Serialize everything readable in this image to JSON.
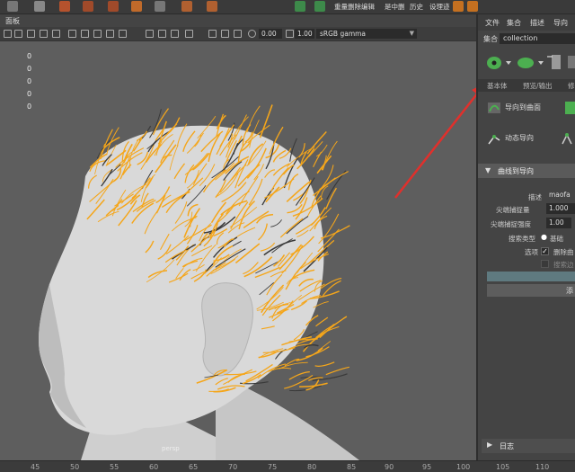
{
  "colors": {
    "hair": "#f5a61a",
    "head": "#d9d9d9",
    "viewport_bg": "#5e5e5e",
    "panel_bg": "#444444",
    "annotation_arrow": "#e0302c",
    "accent_green": "#4caf50"
  },
  "top_toolbar": {
    "labels": [
      "重量删除编辑",
      "是中删",
      "历史",
      "设理迹"
    ]
  },
  "viewport": {
    "panel_menu_label": "面板",
    "zero_readouts": [
      "0",
      "0",
      "0",
      "0",
      "0"
    ],
    "field_value_1": "0.00",
    "field_value_2": "1.00",
    "color_space": "sRGB gamma",
    "camera_label": "persp"
  },
  "right_panel": {
    "menu": [
      "文件",
      "集合",
      "描述",
      "导向"
    ],
    "collection_label": "集合",
    "collection_value": "collection",
    "tabs": [
      "基本体",
      "预览/输出",
      "修"
    ],
    "tools": {
      "guide_to_curve": "导向到曲面",
      "dynamic_guide": "动态导向"
    },
    "section_title": "曲线到导向",
    "fields": {
      "description_label": "描述",
      "description_value": "maofa",
      "tip_capture_label": "尖端捕捉量",
      "tip_capture_value": "1.000",
      "tip_strength_label": "尖端捕捉强度",
      "tip_strength_value": "1.00",
      "search_type_label": "搜索类型",
      "search_type_value": "基础",
      "options_label": "选项",
      "delete_curves_label": "删除曲",
      "search_label": "搜索边",
      "add_button_label": "添"
    },
    "log_label": "日志"
  },
  "timeline": {
    "ticks": [
      "45",
      "50",
      "55",
      "60",
      "65",
      "70",
      "75",
      "80",
      "85",
      "90",
      "95",
      "100",
      "105",
      "110"
    ]
  }
}
